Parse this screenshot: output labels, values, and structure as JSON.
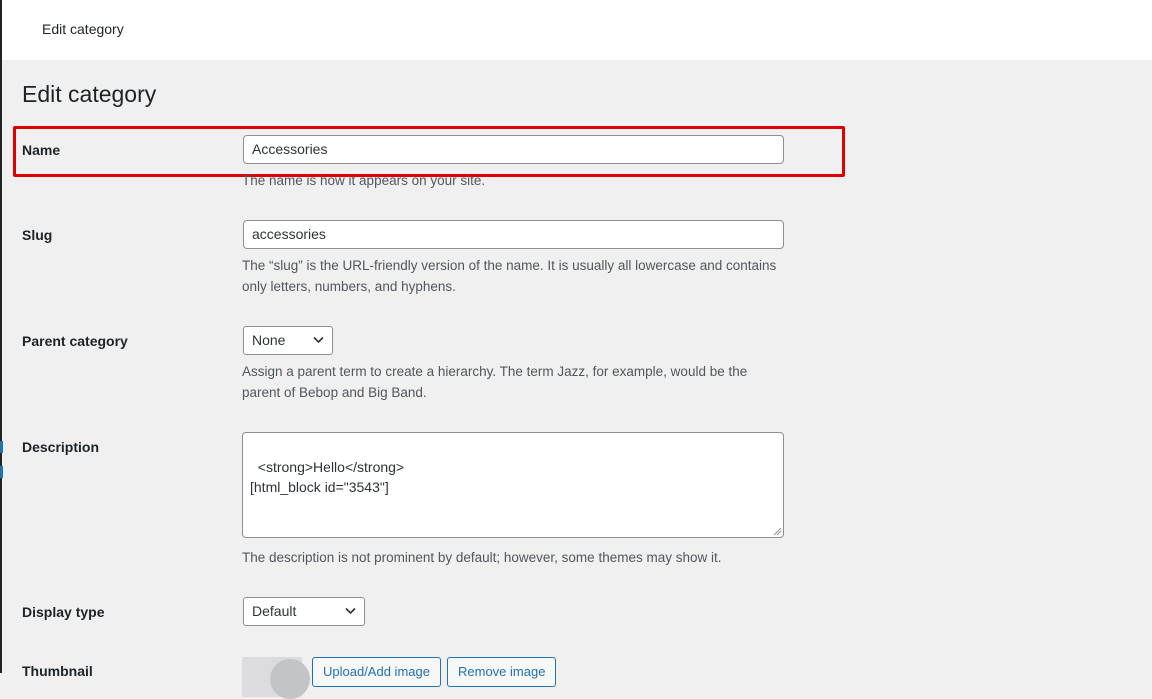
{
  "topbar": {
    "title": "Edit category"
  },
  "page": {
    "heading": "Edit category"
  },
  "form": {
    "name": {
      "label": "Name",
      "value": "Accessories",
      "help": "The name is how it appears on your site."
    },
    "slug": {
      "label": "Slug",
      "value": "accessories",
      "help": "The “slug” is the URL-friendly version of the name. It is usually all lowercase and contains only letters, numbers, and hyphens."
    },
    "parent": {
      "label": "Parent category",
      "selected": "None",
      "help": "Assign a parent term to create a hierarchy. The term Jazz, for example, would be the parent of Bebop and Big Band."
    },
    "description": {
      "label": "Description",
      "value": "<strong>Hello</strong>\n[html_block id=\"3543\"]",
      "help": "The description is not prominent by default; however, some themes may show it."
    },
    "display_type": {
      "label": "Display type",
      "selected": "Default"
    },
    "thumbnail": {
      "label": "Thumbnail",
      "upload_label": "Upload/Add image",
      "remove_label": "Remove image"
    }
  },
  "colors": {
    "highlight": "#e00000",
    "accent": "#2271b1",
    "background": "#f0f0f1"
  }
}
